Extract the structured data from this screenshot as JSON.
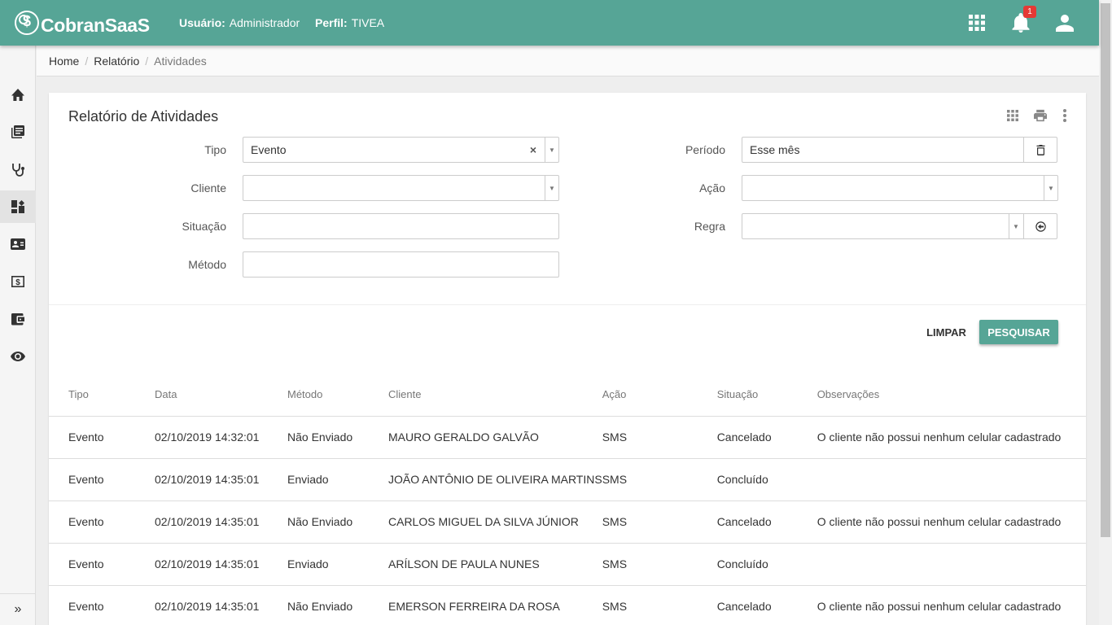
{
  "app": {
    "logo_text": "CobranSaaS"
  },
  "header": {
    "user_label": "Usuário:",
    "user_value": "Administrador",
    "profile_label": "Perfil:",
    "profile_value": "TIVEA",
    "notification_count": "1",
    "icons": [
      "apps-grid-icon",
      "bell-icon",
      "account-icon"
    ]
  },
  "sidebar": {
    "items": [
      {
        "icon": "home-icon"
      },
      {
        "icon": "book-icon"
      },
      {
        "icon": "stethoscope-icon"
      },
      {
        "icon": "dashboard-icon",
        "active": true
      },
      {
        "icon": "contact-card-icon"
      },
      {
        "icon": "money-icon"
      },
      {
        "icon": "wallet-icon"
      },
      {
        "icon": "eye-icon"
      }
    ],
    "expand_label": "»"
  },
  "breadcrumb": {
    "home": "Home",
    "relatorio": "Relatório",
    "current": "Atividades",
    "separator": "/"
  },
  "card": {
    "title": "Relatório de Atividades",
    "tools": [
      "grid-icon",
      "print-icon",
      "more-vert-icon"
    ]
  },
  "filters": {
    "tipo": {
      "label": "Tipo",
      "value": "Evento"
    },
    "cliente": {
      "label": "Cliente",
      "value": ""
    },
    "situacao": {
      "label": "Situação",
      "value": ""
    },
    "metodo": {
      "label": "Método",
      "value": ""
    },
    "periodo": {
      "label": "Período",
      "value": "Esse mês"
    },
    "acao": {
      "label": "Ação",
      "value": ""
    },
    "regra": {
      "label": "Regra",
      "value": ""
    }
  },
  "actions": {
    "clear_label": "LIMPAR",
    "search_label": "PESQUISAR"
  },
  "table": {
    "columns": [
      "Tipo",
      "Data",
      "Método",
      "Cliente",
      "Ação",
      "Situação",
      "Observações"
    ],
    "rows": [
      [
        "Evento",
        "02/10/2019 14:32:01",
        "Não Enviado",
        "MAURO GERALDO GALVÃO",
        "SMS",
        "Cancelado",
        "O cliente não possui nenhum celular cadastrado"
      ],
      [
        "Evento",
        "02/10/2019 14:35:01",
        "Enviado",
        "JOÃO ANTÔNIO DE OLIVEIRA MARTINS",
        "SMS",
        "Concluído",
        ""
      ],
      [
        "Evento",
        "02/10/2019 14:35:01",
        "Não Enviado",
        "CARLOS MIGUEL DA SILVA JÚNIOR",
        "SMS",
        "Cancelado",
        "O cliente não possui nenhum celular cadastrado"
      ],
      [
        "Evento",
        "02/10/2019 14:35:01",
        "Enviado",
        "ARÍLSON DE PAULA NUNES",
        "SMS",
        "Concluído",
        ""
      ],
      [
        "Evento",
        "02/10/2019 14:35:01",
        "Não Enviado",
        "EMERSON FERREIRA DA ROSA",
        "SMS",
        "Cancelado",
        "O cliente não possui nenhum celular cadastrado"
      ]
    ]
  }
}
